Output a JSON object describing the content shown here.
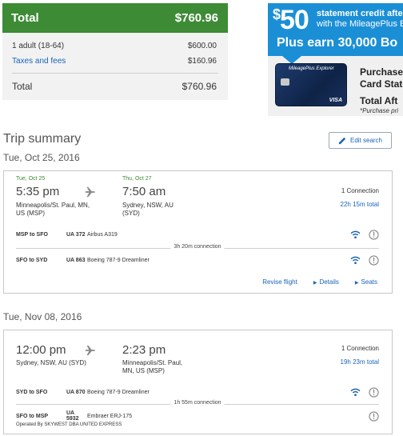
{
  "price": {
    "title": "Total",
    "total": "$760.96",
    "rows": [
      {
        "label": "1 adult (18-64)",
        "value": "$600.00"
      },
      {
        "label": "Taxes and fees",
        "value": "$160.96"
      }
    ],
    "total_label": "Total",
    "total_value": "$760.96"
  },
  "ad": {
    "dollar": "$",
    "amount": "50",
    "line1": "statement credit after",
    "line2": "with the MileagePlus E",
    "line3": "Plus earn 30,000 Bo",
    "card_brand": "MileagePlus Explorer",
    "card_network": "VISA",
    "t1": "Purchase",
    "t2": "Card State",
    "t3": "Total Aft",
    "t4": "*Purchase pri"
  },
  "summary": {
    "title": "Trip summary",
    "edit_label": "Edit search"
  },
  "trips": [
    {
      "date": "Tue, Oct 25, 2016",
      "dep_label": "Tue, Oct 25",
      "dep_time": "5:35 pm",
      "dep_city1": "Minneapolis/St. Paul, MN,",
      "dep_city2": "US (MSP)",
      "arr_label": "Thu, Oct 27",
      "arr_time": "7:50 am",
      "arr_city1": "Sydney, NSW, AU",
      "arr_city2": "(SYD)",
      "connections": "1 Connection",
      "duration": "22h 15m total",
      "seg1": {
        "route": "MSP to SFO",
        "flight": "UA 372",
        "aircraft": "Airbus A319"
      },
      "layover": "3h 20m connection",
      "seg2": {
        "route": "SFO to SYD",
        "flight": "UA 863",
        "aircraft": "Boeing 787-9 Dreamliner"
      },
      "links": {
        "revise": "Revise flight",
        "details": "Details",
        "seats": "Seats"
      }
    },
    {
      "date": "Tue, Nov 08, 2016",
      "dep_time": "12:00 pm",
      "dep_city1": "Sydney, NSW, AU (SYD)",
      "arr_time": "2:23 pm",
      "arr_city1": "Minneapolis/St. Paul,",
      "arr_city2": "MN, US (MSP)",
      "connections": "1 Connection",
      "duration": "19h 23m total",
      "seg1": {
        "route": "SYD to SFO",
        "flight": "UA 870",
        "aircraft": "Boeing 787-9 Dreamliner"
      },
      "layover": "1h 55m connection",
      "seg2": {
        "route": "SFO to MSP",
        "flight": "UA 5932",
        "aircraft": "Embraer ERJ-175"
      },
      "operated_by": "Operated By SKYWEST DBA UNITED EXPRESS"
    }
  ],
  "colors": {
    "green": "#3d8b35",
    "link": "#1a64b8",
    "ad_blue": "#1b8fd6"
  },
  "icons": [
    "plane-icon",
    "wifi-icon",
    "info-icon",
    "pencil-icon",
    "triangle-right-icon"
  ]
}
